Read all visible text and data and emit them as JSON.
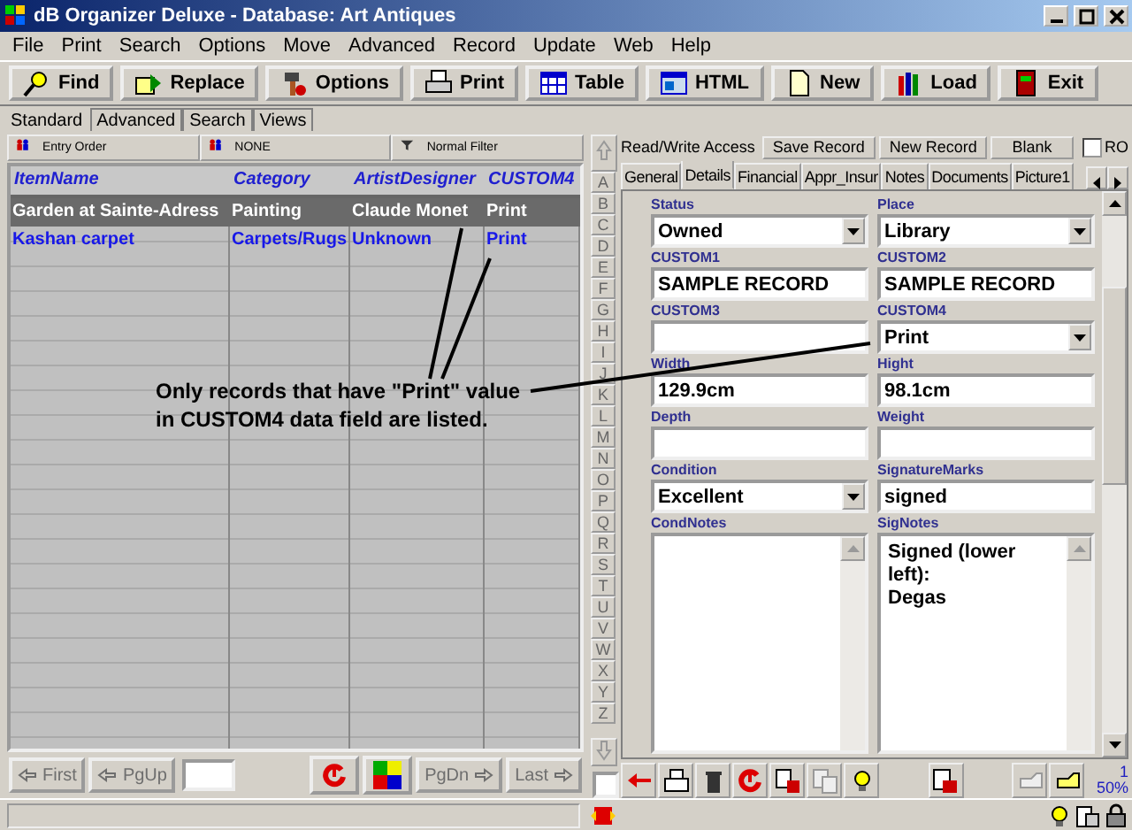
{
  "window": {
    "title": "dB Organizer Deluxe - Database: Art Antiques"
  },
  "menu": [
    "File",
    "Print",
    "Search",
    "Options",
    "Move",
    "Advanced",
    "Record",
    "Update",
    "Web",
    "Help"
  ],
  "toolbar": [
    "Find",
    "Replace",
    "Options",
    "Print",
    "Table",
    "HTML",
    "New",
    "Load",
    "Exit"
  ],
  "view_tabs": [
    {
      "label": "Standard",
      "selected": true
    },
    {
      "label": "Advanced",
      "selected": false
    },
    {
      "label": "Search",
      "selected": false
    },
    {
      "label": "Views",
      "selected": false
    }
  ],
  "filter_bar": [
    "Entry Order",
    "NONE",
    "Normal Filter"
  ],
  "grid": {
    "columns": [
      "ItemName",
      "Category",
      "ArtistDesigner",
      "CUSTOM4"
    ],
    "rows": [
      {
        "cells": [
          "Garden at Sainte-Adress",
          "Painting",
          "Claude Monet",
          "Print"
        ],
        "selected": true
      },
      {
        "cells": [
          "Kashan carpet",
          "Carpets/Rugs",
          "Unknown",
          "Print"
        ],
        "selected": false
      }
    ]
  },
  "nav": {
    "buttons": [
      {
        "label": "First",
        "disabled": true
      },
      {
        "label": "PgUp",
        "disabled": true
      },
      {
        "label": "PgDn",
        "disabled": true
      },
      {
        "label": "Last",
        "disabled": true
      }
    ]
  },
  "record_bar": {
    "access": "Read/Write Access",
    "buttons": [
      "Save Record",
      "New Record",
      "Blank"
    ],
    "readonly": {
      "label": "RO",
      "checked": false
    }
  },
  "record_tabs": [
    {
      "label": "General",
      "selected": false
    },
    {
      "label": "Details",
      "selected": true
    },
    {
      "label": "Financial",
      "selected": false
    },
    {
      "label": "Appr_Insur",
      "selected": false
    },
    {
      "label": "Notes",
      "selected": false
    },
    {
      "label": "Documents",
      "selected": false
    },
    {
      "label": "Picture1",
      "selected": false
    }
  ],
  "index_checkbox": {
    "checked": false
  },
  "alpha_index": [
    "A",
    "B",
    "C",
    "D",
    "E",
    "F",
    "G",
    "H",
    "I",
    "J",
    "K",
    "L",
    "M",
    "N",
    "O",
    "P",
    "Q",
    "R",
    "S",
    "T",
    "U",
    "V",
    "W",
    "X",
    "Y",
    "Z"
  ],
  "fields": [
    {
      "label": "Status",
      "value": "Owned",
      "kind": "select"
    },
    {
      "label": "Place",
      "value": "Library",
      "kind": "select"
    },
    {
      "label": "CUSTOM1",
      "value": "SAMPLE RECORD",
      "kind": "text"
    },
    {
      "label": "CUSTOM2",
      "value": "SAMPLE RECORD",
      "kind": "text"
    },
    {
      "label": "CUSTOM3",
      "kind": "text"
    },
    {
      "label": "CUSTOM4",
      "value": "Print",
      "kind": "select"
    },
    {
      "label": "Width",
      "value": "129.9cm",
      "kind": "text"
    },
    {
      "label": "Hight",
      "value": "98.1cm",
      "kind": "text"
    },
    {
      "label": "Depth",
      "kind": "text"
    },
    {
      "label": "Weight",
      "kind": "text"
    },
    {
      "label": "Condition",
      "value": "Excellent",
      "kind": "select"
    },
    {
      "label": "SignatureMarks",
      "value": "signed",
      "kind": "text"
    },
    {
      "label": "CondNotes",
      "kind": "memo"
    },
    {
      "label": "SigNotes",
      "value": "Signed (lower left):\nDegas",
      "kind": "memo"
    }
  ],
  "record_count": {
    "number": "1",
    "percent": "50%"
  },
  "annotation": {
    "lines": [
      "Only records that have \"Print\" value",
      "in CUSTOM4 data field are listed."
    ]
  }
}
